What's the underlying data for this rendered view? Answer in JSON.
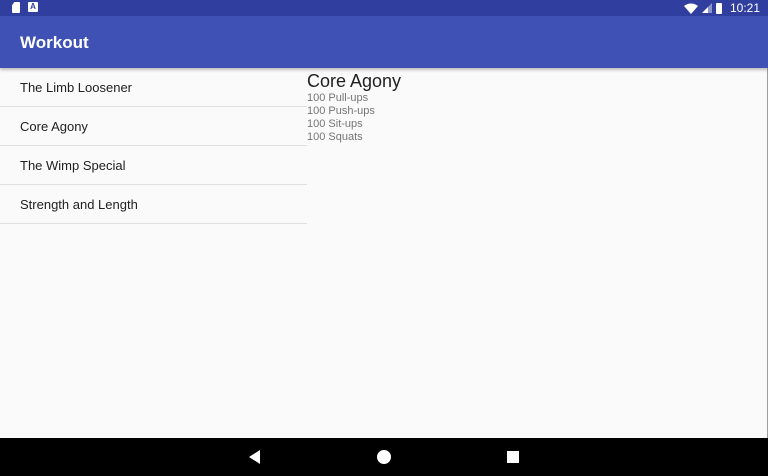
{
  "status_bar": {
    "time": "10:21",
    "left_icons": [
      "sd-card-icon",
      "a-notification-icon"
    ],
    "right_icons": [
      "wifi-icon",
      "signal-icon",
      "battery-icon"
    ],
    "a_badge": "A"
  },
  "app_bar": {
    "title": "Workout",
    "color": "#3f51b5"
  },
  "workouts": [
    {
      "label": "The Limb Loosener"
    },
    {
      "label": "Core Agony"
    },
    {
      "label": "The Wimp Special"
    },
    {
      "label": "Strength and Length"
    }
  ],
  "detail": {
    "title": "Core Agony",
    "lines": [
      "100 Pull-ups",
      "100 Push-ups",
      "100 Sit-ups",
      "100 Squats"
    ]
  },
  "nav_bar": {
    "buttons": [
      "back-icon",
      "home-icon",
      "recents-icon"
    ]
  }
}
